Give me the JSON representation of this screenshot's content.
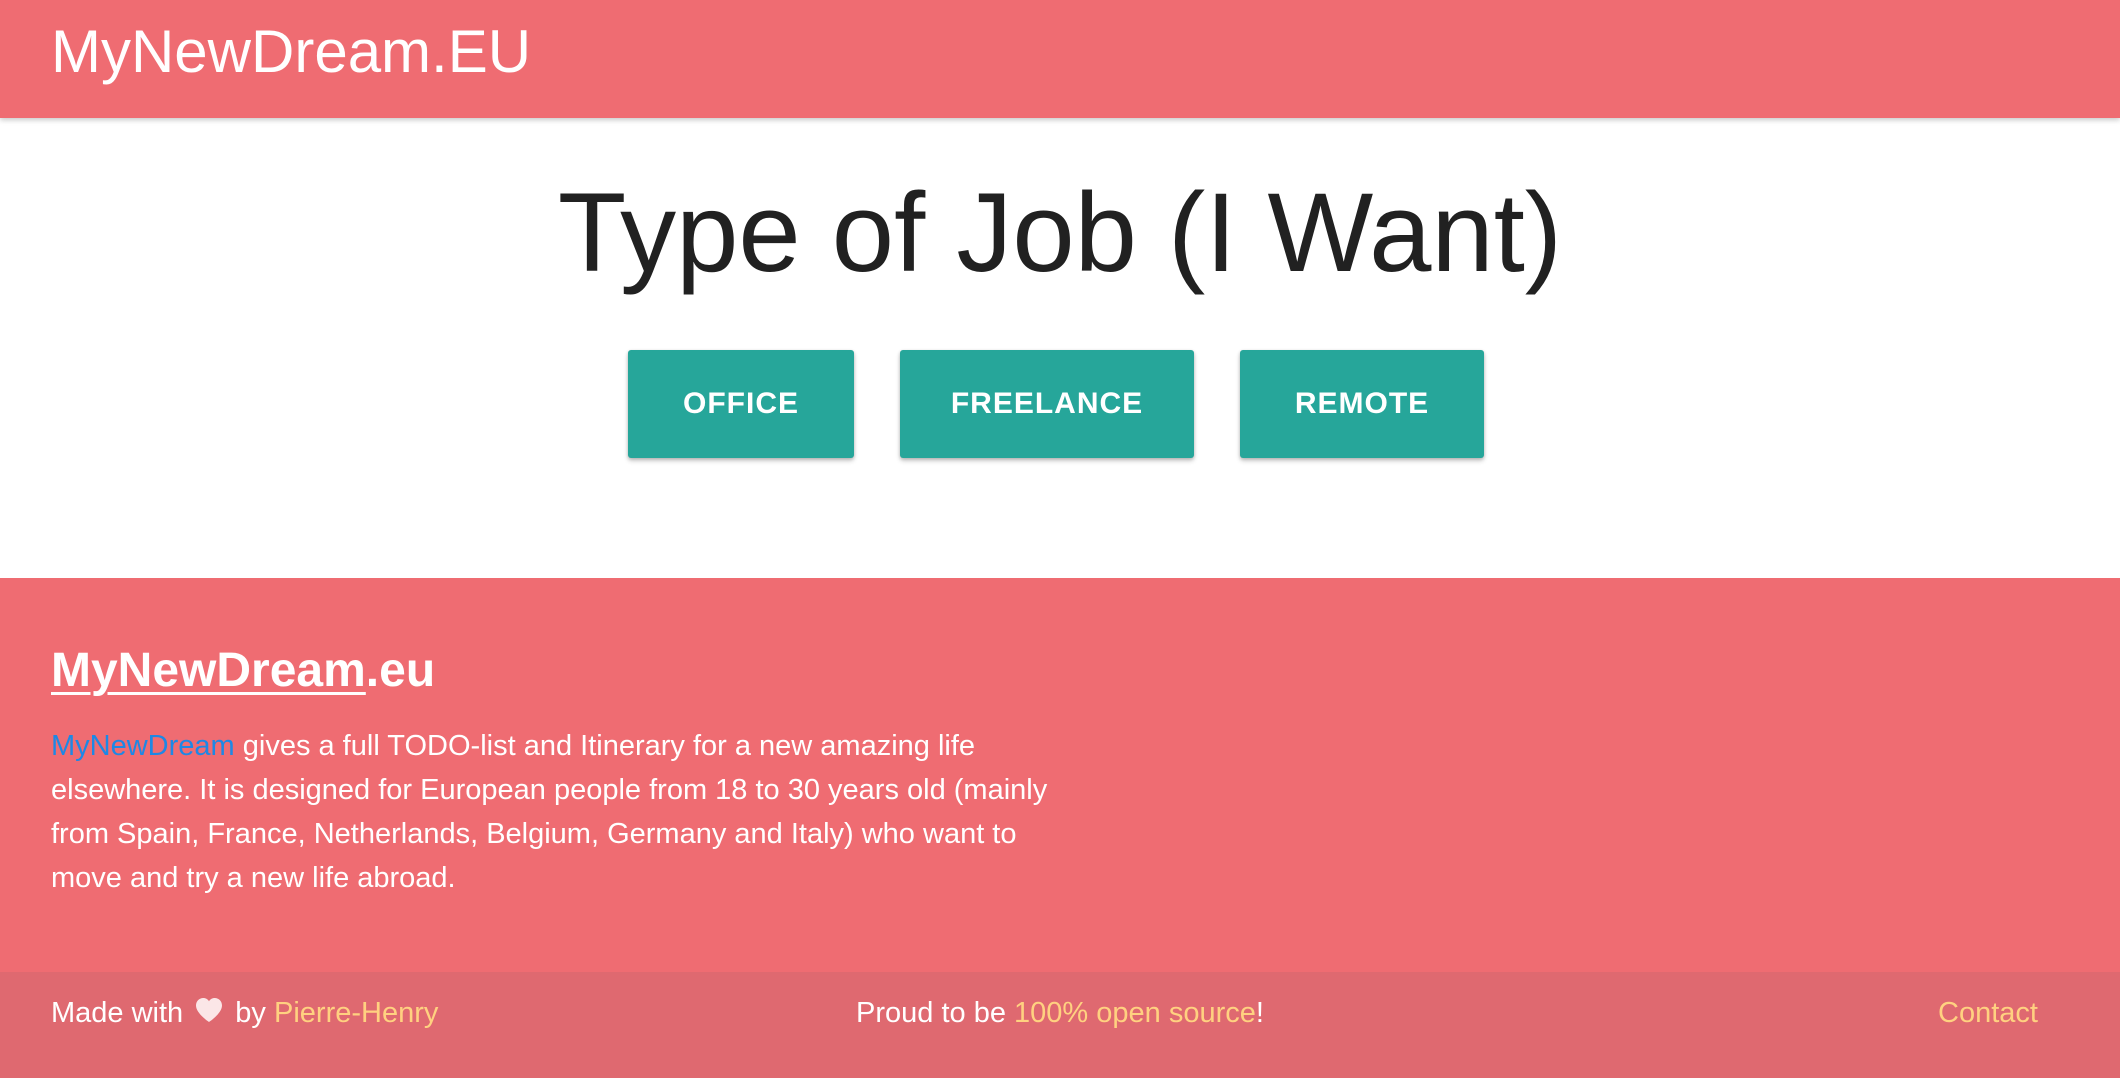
{
  "header": {
    "brand": "MyNewDream.EU"
  },
  "main": {
    "title": "Type of Job (I Want)",
    "buttons": [
      "OFFICE",
      "FREELANCE",
      "REMOTE"
    ],
    "button_color": "#26a69a"
  },
  "footer": {
    "heading_link": "MyNewDream",
    "heading_suffix": ".eu",
    "text_link": "MyNewDream",
    "text_body": " gives a full TODO-list and Itinerary for a new amazing life elsewhere. It is designed for European people from 18 to 30 years old (mainly from Spain, France, Netherlands, Belgium, Germany and Italy) who want to move and try a new life abroad.",
    "made_with": "Made with",
    "heart_icon": "heart-icon",
    "by": "by",
    "author": "Pierre-Henry",
    "proud_prefix": "Proud to be ",
    "open_source": "100% open source",
    "proud_suffix": "!",
    "contact": "Contact"
  },
  "colors": {
    "primary": "#ef6c72",
    "footer_bottom": "#df6970",
    "accent_link": "#ffd180",
    "blue_link": "#1e88e5",
    "text_dark": "#212121"
  }
}
